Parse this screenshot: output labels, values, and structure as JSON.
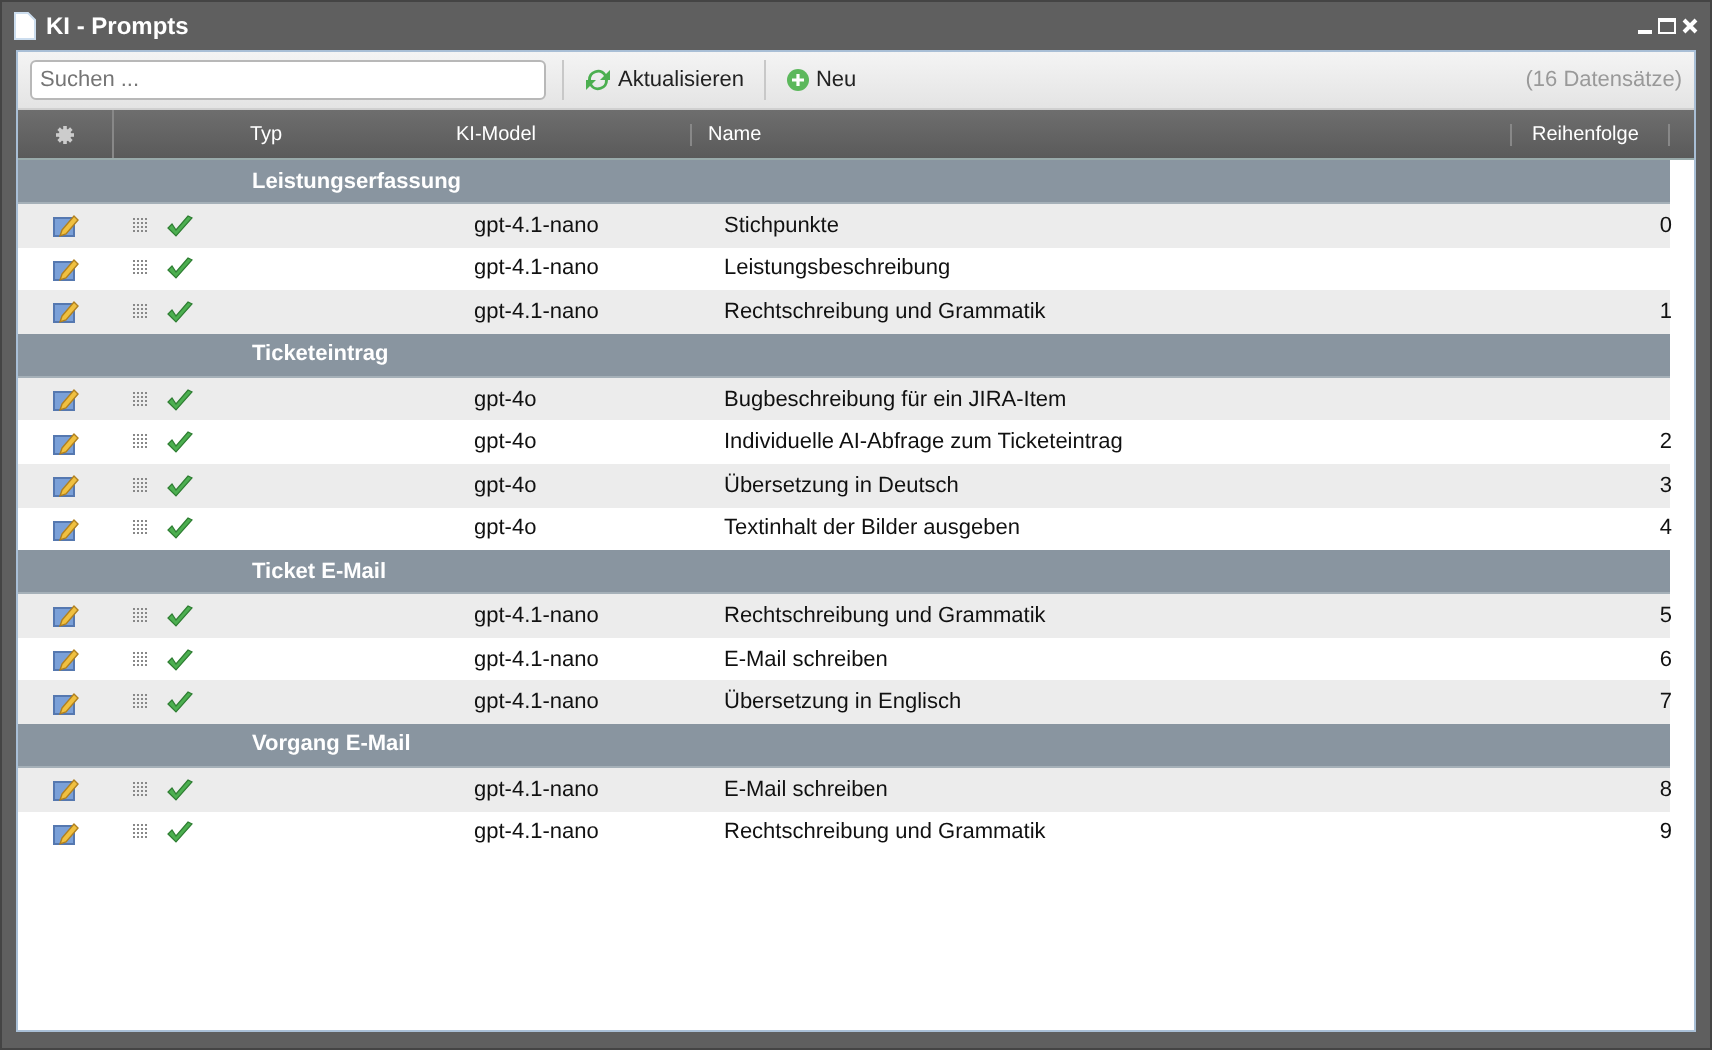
{
  "window": {
    "title": "KI - Prompts"
  },
  "toolbar": {
    "search": {
      "placeholder": "Suchen ..."
    },
    "buttons": [
      {
        "kind": "refresh",
        "label": "Aktualisieren"
      },
      {
        "kind": "add",
        "label": "Neu"
      }
    ],
    "count": "(16 Datensätze)"
  },
  "table": {
    "columns": [
      "Typ",
      "KI-Model",
      "Name",
      "Reihenfolge"
    ],
    "groups": [
      {
        "title": "Leistungserfassung",
        "rows": [
          {
            "active": true,
            "model": "gpt-4.1-nano",
            "name": "Stichpunkte",
            "order": "0"
          },
          {
            "active": true,
            "model": "gpt-4.1-nano",
            "name": "Leistungsbeschreibung"
          },
          {
            "active": true,
            "model": "gpt-4.1-nano",
            "name": "Rechtschreibung und Grammatik",
            "order": "1"
          }
        ]
      },
      {
        "title": "Ticketeintrag",
        "rows": [
          {
            "active": true,
            "model": "gpt-4o",
            "name": "Bugbeschreibung für ein JIRA-Item"
          },
          {
            "active": true,
            "model": "gpt-4o",
            "name": "Individuelle AI-Abfrage zum Ticketeintrag",
            "order": "2"
          },
          {
            "active": true,
            "model": "gpt-4o",
            "name": "Übersetzung in Deutsch",
            "order": "3"
          },
          {
            "active": true,
            "model": "gpt-4o",
            "name": "Textinhalt der Bilder ausgeben",
            "order": "4"
          }
        ]
      },
      {
        "title": "Ticket E-Mail",
        "rows": [
          {
            "active": true,
            "model": "gpt-4.1-nano",
            "name": "Rechtschreibung und Grammatik",
            "order": "5"
          },
          {
            "active": true,
            "model": "gpt-4.1-nano",
            "name": "E-Mail schreiben",
            "order": "6"
          },
          {
            "active": true,
            "model": "gpt-4.1-nano",
            "name": "Übersetzung in Englisch",
            "order": "7"
          }
        ]
      },
      {
        "title": "Vorgang E-Mail",
        "rows": [
          {
            "active": true,
            "model": "gpt-4.1-nano",
            "name": "E-Mail schreiben",
            "order": "8"
          },
          {
            "active": true,
            "model": "gpt-4.1-nano",
            "name": "Rechtschreibung und Grammatik",
            "order": "9"
          }
        ]
      }
    ]
  }
}
